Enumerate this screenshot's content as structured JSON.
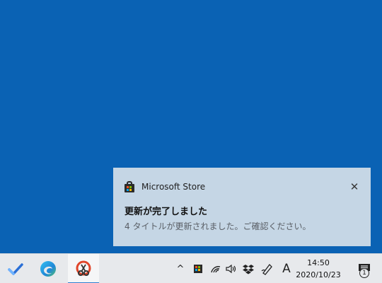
{
  "toast": {
    "app_name": "Microsoft Store",
    "close_glyph": "✕",
    "title": "更新が完了しました",
    "body": "4 タイトルが更新されました。ご確認ください。",
    "icon": "microsoft-store-icon"
  },
  "taskbar": {
    "pinned": [
      {
        "name": "todo-checkmark-icon",
        "active": false
      },
      {
        "name": "edge-browser-icon",
        "active": false
      },
      {
        "name": "snipping-tool-icon",
        "active": true
      }
    ],
    "tray": {
      "chevron": "^",
      "ime": "A",
      "icons": [
        "hidden-icons-chevron",
        "store-tray-icon",
        "wifi-icon",
        "volume-icon",
        "dropbox-icon",
        "pen-icon",
        "ime-mode-icon"
      ]
    },
    "clock": {
      "time": "14:50",
      "date": "2020/10/23"
    },
    "notifications": {
      "badge": "1"
    }
  },
  "colors": {
    "desktop": "#0a62b4",
    "toast_bg": "#c5d6e5",
    "taskbar_bg": "#e7e9ec",
    "accent": "#2f7fd1"
  }
}
